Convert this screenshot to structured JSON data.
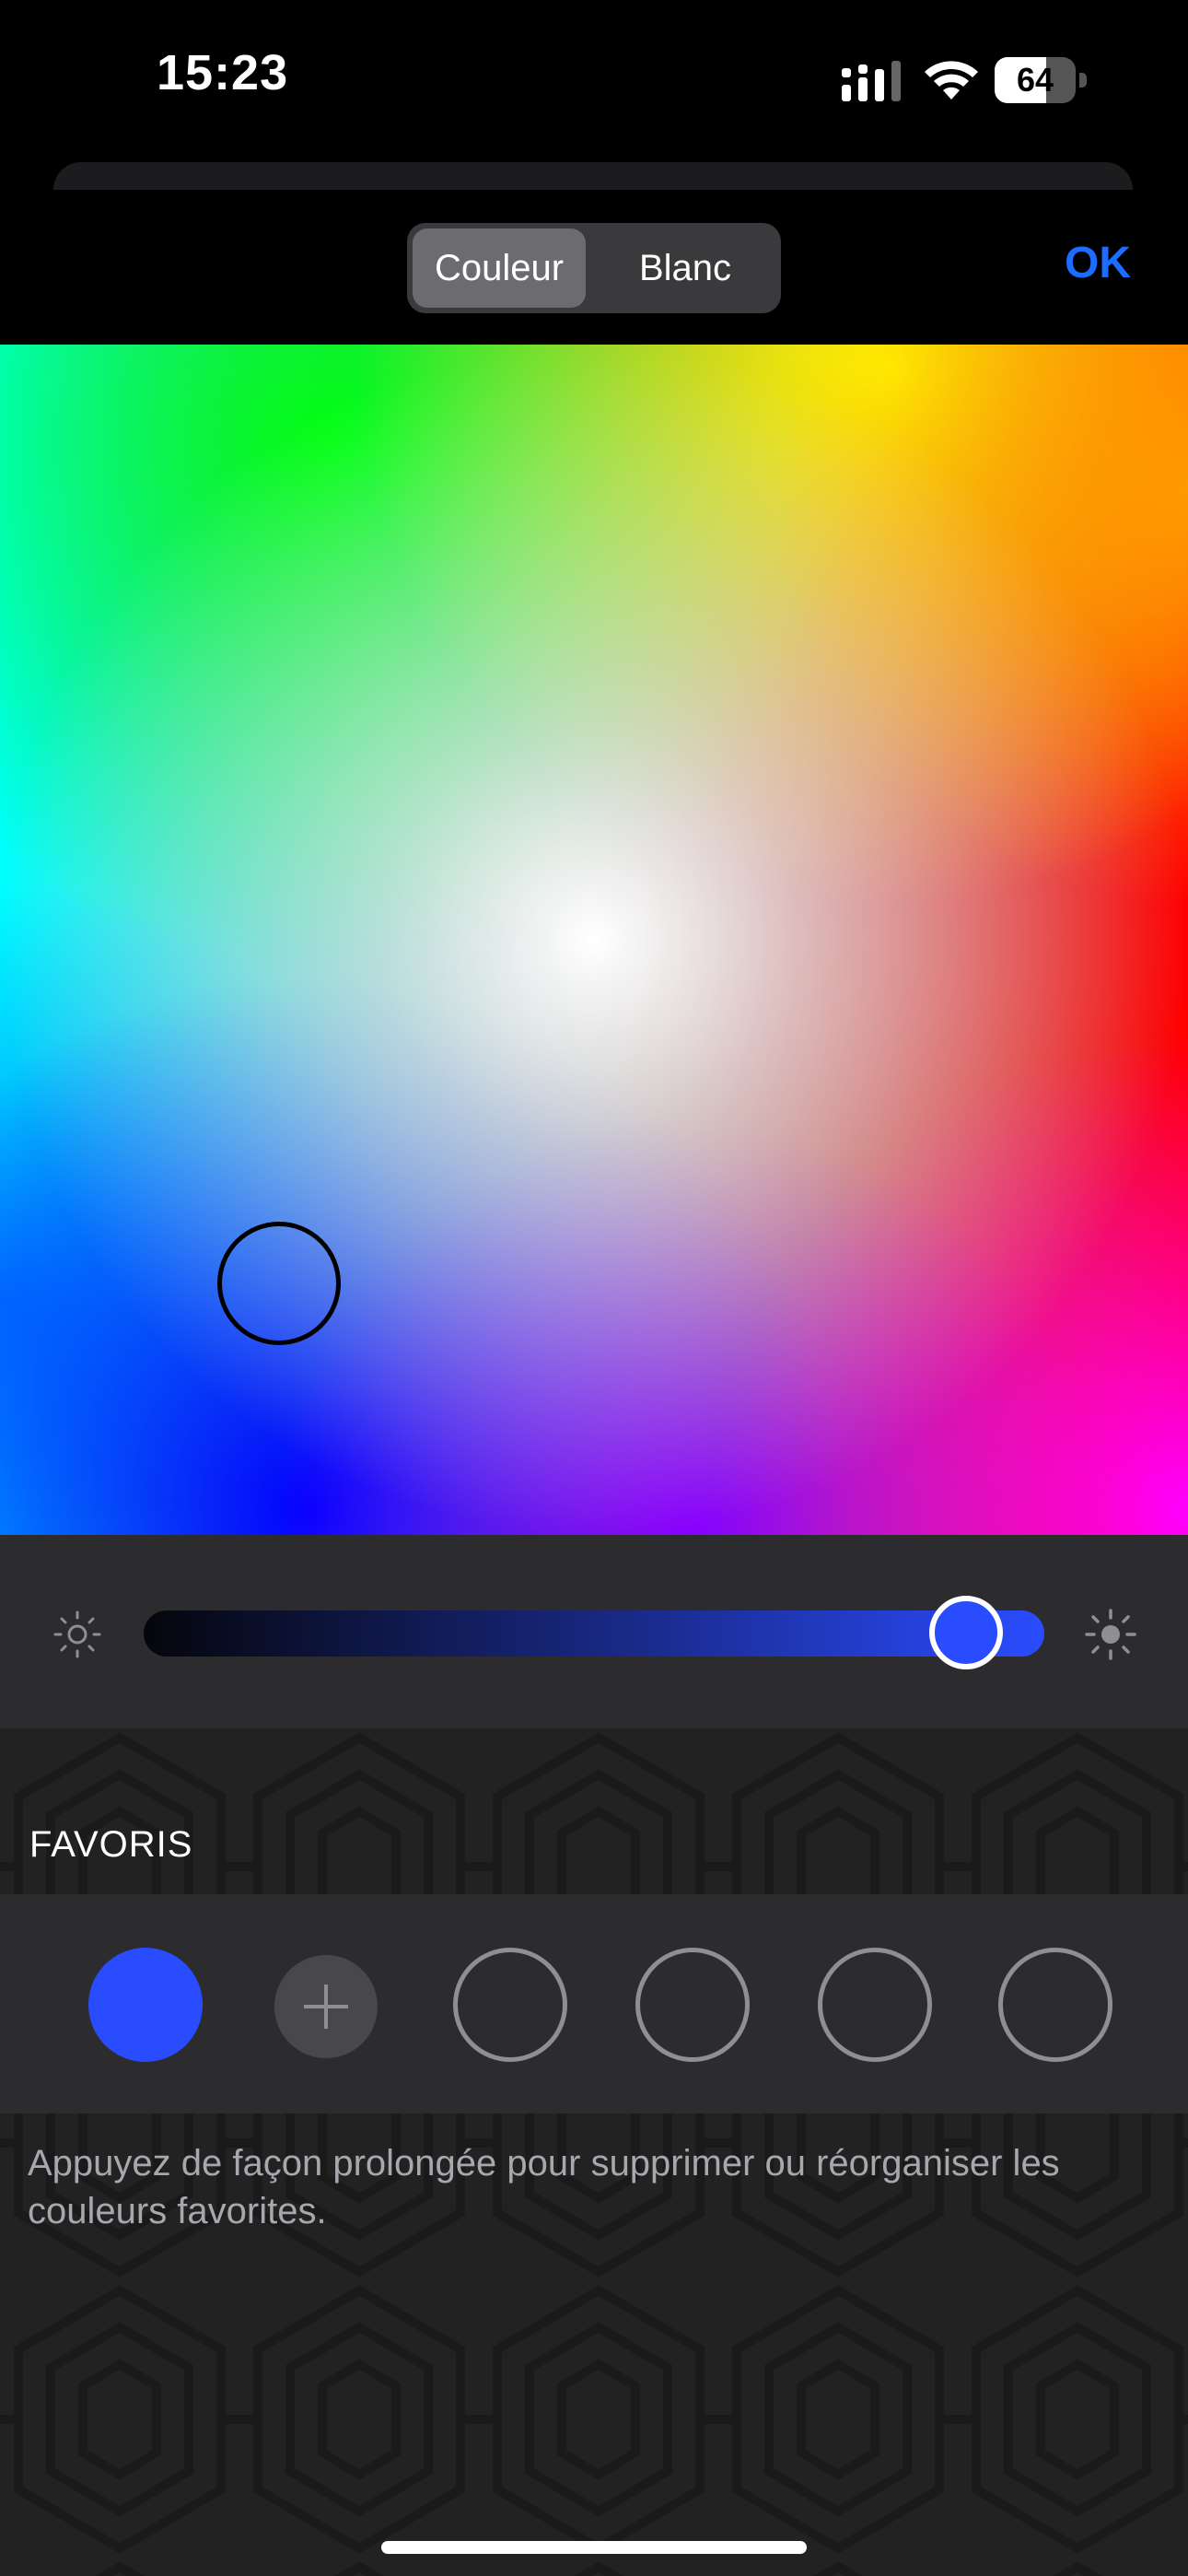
{
  "status_bar": {
    "time": "15:23",
    "battery": "64"
  },
  "header": {
    "segments": [
      "Couleur",
      "Blanc"
    ],
    "selected_segment": "Couleur",
    "ok_label": "OK",
    "accent_color": "#1e6bff"
  },
  "color_picker": {
    "selected_color": "#2a4cff"
  },
  "brightness": {
    "level": 0.95,
    "low_icon": "sun-dim-icon",
    "high_icon": "sun-bright-icon"
  },
  "favorites": {
    "title": "FAVORIS",
    "add_icon": "plus-icon",
    "items": [
      {
        "color": "#2a4cff"
      }
    ],
    "hint": "Appuyez de façon prolongée pour supprimer ou réorganiser les couleurs favorites."
  }
}
